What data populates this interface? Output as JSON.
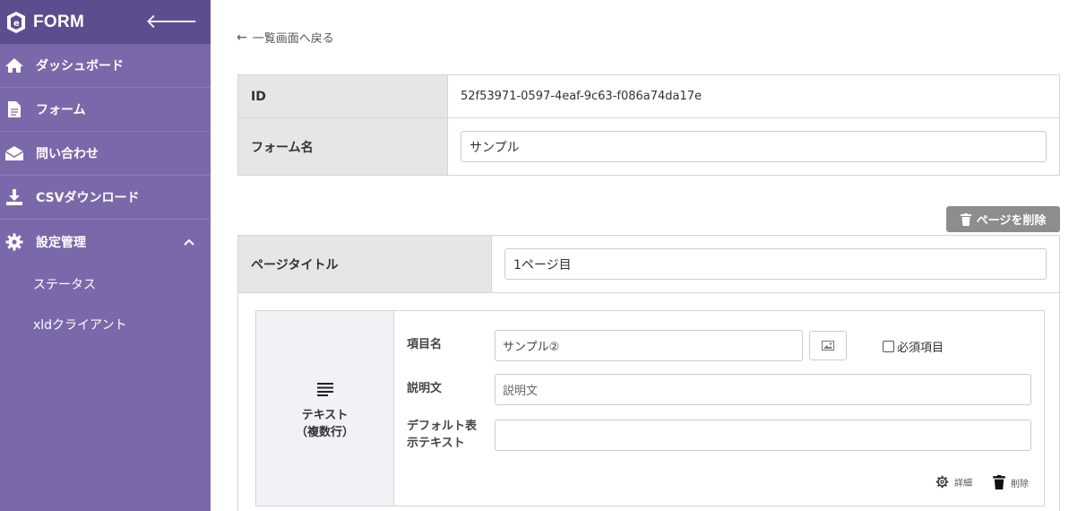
{
  "sidebar": {
    "brand": "FORM",
    "items": [
      {
        "label": "ダッシュボード",
        "icon": "home-icon"
      },
      {
        "label": "フォーム",
        "icon": "document-icon"
      },
      {
        "label": "問い合わせ",
        "icon": "envelope-icon"
      },
      {
        "label": "CSVダウンロード",
        "icon": "download-icon"
      },
      {
        "label": "設定管理",
        "icon": "gear-icon"
      }
    ],
    "subitems": [
      {
        "label": "ステータス"
      },
      {
        "label": "xldクライアント"
      }
    ]
  },
  "back_link": "一覧画面へ戻る",
  "form_info": {
    "id_label": "ID",
    "id_value": "52f53971-0597-4eaf-9c63-f086a74da17e",
    "name_label": "フォーム名",
    "name_value": "サンプル"
  },
  "page": {
    "delete_label": "ページを削除",
    "title_label": "ページタイトル",
    "title_value": "1ページ目"
  },
  "field": {
    "type_line1": "テキスト",
    "type_line2": "（複数行）",
    "item_name_label": "項目名",
    "item_name_value": "サンプル②",
    "required_label": "必須項目",
    "description_label": "説明文",
    "description_placeholder": "説明文",
    "default_label_line1": "デフォルト表",
    "default_label_line2": "示テキスト",
    "default_value": "",
    "detail_label": "詳細",
    "delete_label": "削除"
  },
  "colors": {
    "sidebar": "#7b68aa",
    "sidebar_header": "#5e4d8e",
    "delete_button": "#8d8d8d"
  }
}
